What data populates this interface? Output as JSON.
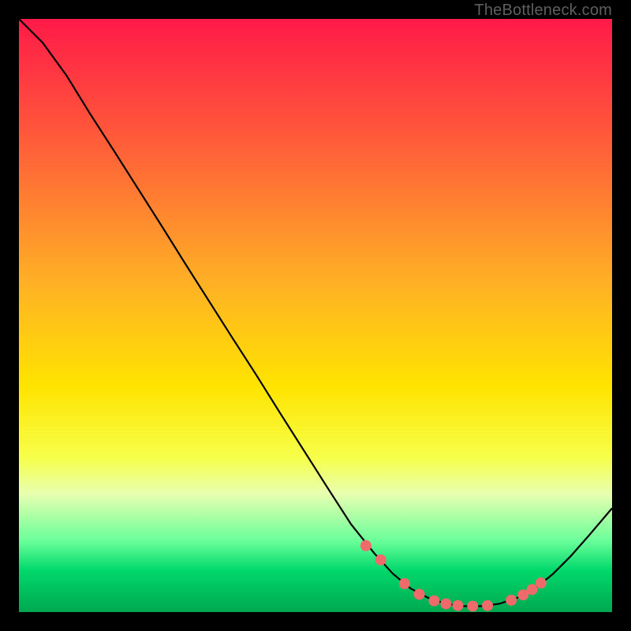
{
  "watermark": "TheBottleneck.com",
  "chart_data": {
    "type": "line",
    "title": "",
    "xlabel": "",
    "ylabel": "",
    "xlim": [
      0,
      100
    ],
    "ylim": [
      0,
      100
    ],
    "gradient_stops": [
      {
        "offset": 0,
        "color": "#ff1a48"
      },
      {
        "offset": 20,
        "color": "#ff5a3a"
      },
      {
        "offset": 45,
        "color": "#ffb224"
      },
      {
        "offset": 62,
        "color": "#ffe400"
      },
      {
        "offset": 74,
        "color": "#f6ff4a"
      },
      {
        "offset": 80,
        "color": "#e8ffb0"
      },
      {
        "offset": 88,
        "color": "#6aff9a"
      },
      {
        "offset": 93,
        "color": "#00d86a"
      },
      {
        "offset": 100,
        "color": "#00a850"
      }
    ],
    "curve": [
      {
        "x": 0,
        "y": 100.0
      },
      {
        "x": 4,
        "y": 96.0
      },
      {
        "x": 8,
        "y": 90.5
      },
      {
        "x": 12,
        "y": 84.0
      },
      {
        "x": 16,
        "y": 77.8
      },
      {
        "x": 20,
        "y": 71.5
      },
      {
        "x": 24,
        "y": 65.2
      },
      {
        "x": 28,
        "y": 58.8
      },
      {
        "x": 32,
        "y": 52.5
      },
      {
        "x": 36,
        "y": 46.2
      },
      {
        "x": 40,
        "y": 40.0
      },
      {
        "x": 44,
        "y": 33.6
      },
      {
        "x": 48,
        "y": 27.3
      },
      {
        "x": 52,
        "y": 21.0
      },
      {
        "x": 56,
        "y": 14.8
      },
      {
        "x": 60,
        "y": 9.8
      },
      {
        "x": 63,
        "y": 6.5
      },
      {
        "x": 66,
        "y": 4.0
      },
      {
        "x": 69,
        "y": 2.4
      },
      {
        "x": 72,
        "y": 1.4
      },
      {
        "x": 75,
        "y": 1.0
      },
      {
        "x": 78,
        "y": 1.0
      },
      {
        "x": 81,
        "y": 1.4
      },
      {
        "x": 84,
        "y": 2.4
      },
      {
        "x": 87,
        "y": 4.0
      },
      {
        "x": 90,
        "y": 6.4
      },
      {
        "x": 93,
        "y": 9.4
      },
      {
        "x": 96,
        "y": 12.8
      },
      {
        "x": 100,
        "y": 17.5
      }
    ],
    "markers": [
      {
        "x": 58.5,
        "y": 11.2
      },
      {
        "x": 61.0,
        "y": 8.8
      },
      {
        "x": 65.0,
        "y": 4.8
      },
      {
        "x": 67.5,
        "y": 3.0
      },
      {
        "x": 70.0,
        "y": 1.9
      },
      {
        "x": 72.0,
        "y": 1.4
      },
      {
        "x": 74.0,
        "y": 1.1
      },
      {
        "x": 76.5,
        "y": 1.0
      },
      {
        "x": 79.0,
        "y": 1.1
      },
      {
        "x": 83.0,
        "y": 2.0
      },
      {
        "x": 85.0,
        "y": 2.9
      },
      {
        "x": 86.5,
        "y": 3.8
      },
      {
        "x": 88.0,
        "y": 4.9
      }
    ]
  }
}
